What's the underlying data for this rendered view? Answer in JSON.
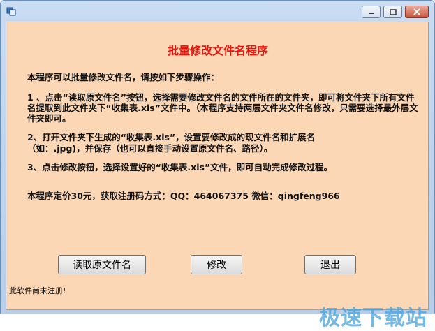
{
  "window": {
    "controls": {
      "minimize": "minimize-icon",
      "maximize": "maximize-icon",
      "close": "close-icon"
    }
  },
  "content": {
    "title": "批量修改文件名程序",
    "intro": "本程序可以批量修改文件名，请按如下步骤操作：",
    "step1": "1 、点击“读取原文件名”按钮，选择需要修改文件名的文件所在的文件夹，即可将文件夹下所有文件名提取到此文件夹下“收集表.xls”文件中。（本程序支持两层文件夹文件名修改，只需要选择最外层文件夹即可。",
    "step2_line1": "2、打开文件夹下生成的“收集表.xls”，设置要修改成的现文件名和扩展名",
    "step2_line2": "（如：.jpg)，并保存（也可以直接手动设置原文件名、路径）。",
    "step3": "3、点击修改按钮，选择设置好的“收集表.xls”文件，即可自动完成修改过程。",
    "price": "本程序定价30元，获取注册码方式：QQ：464067375   微信：qingfeng966"
  },
  "buttons": {
    "read": "读取原文件名",
    "modify": "修改",
    "exit": "退出"
  },
  "status": "此软件尚未注册!",
  "watermark": "极速下载站"
}
